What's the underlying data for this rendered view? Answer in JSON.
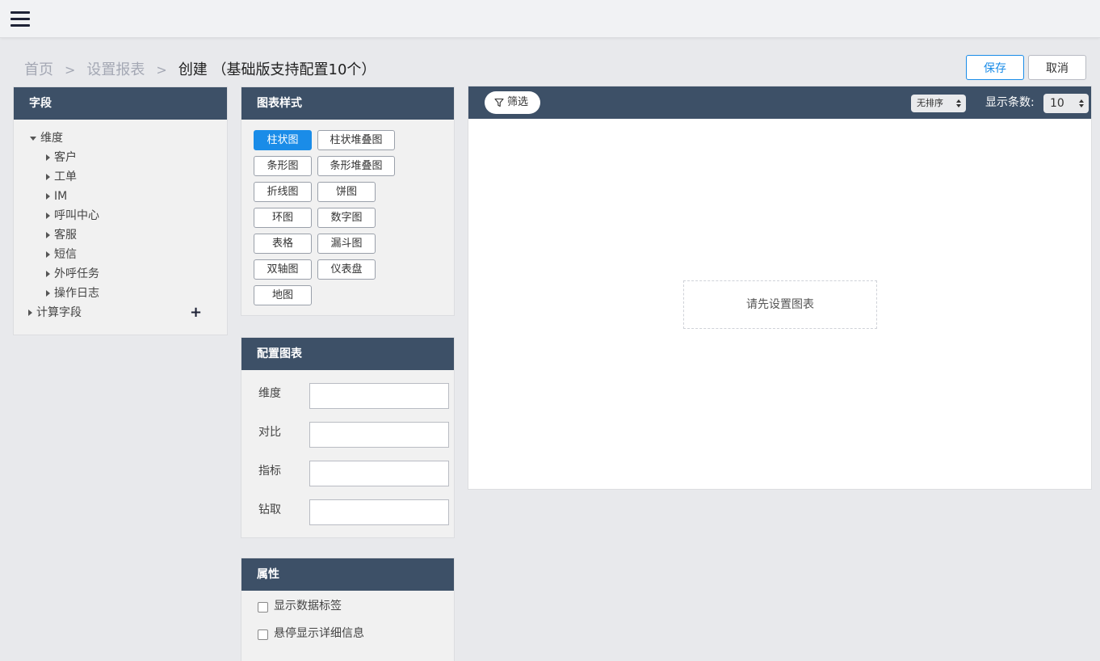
{
  "breadcrumb": {
    "home": "首页",
    "sep1": ">",
    "settings": "设置报表",
    "sep2": ">",
    "current": "创建 （基础版支持配置10个）"
  },
  "actions": {
    "save": "保存",
    "cancel": "取消"
  },
  "fields": {
    "title": "字段",
    "root": "维度",
    "items": [
      "客户",
      "工单",
      "IM",
      "呼叫中心",
      "客服",
      "短信",
      "外呼任务",
      "操作日志"
    ],
    "calc": "计算字段"
  },
  "chart_styles": {
    "title": "图表样式",
    "rows": [
      [
        "柱状图",
        "柱状堆叠图"
      ],
      [
        "条形图",
        "条形堆叠图"
      ],
      [
        "折线图",
        "饼图"
      ],
      [
        "环图",
        "数字图"
      ],
      [
        "表格",
        "漏斗图"
      ],
      [
        "双轴图",
        "仪表盘"
      ],
      [
        "地图"
      ]
    ],
    "selected": "柱状图"
  },
  "config": {
    "title": "配置图表",
    "labels": [
      "维度",
      "对比",
      "指标",
      "钻取"
    ]
  },
  "props": {
    "title": "属性",
    "options": [
      "显示数据标签",
      "悬停显示详细信息"
    ]
  },
  "chart_area": {
    "filter": "筛选",
    "sort": "无排序",
    "count_label": "显示条数:",
    "count_value": "10",
    "placeholder": "请先设置图表"
  },
  "colors": {
    "header": "#3d5067",
    "accent": "#1a8ce8"
  }
}
